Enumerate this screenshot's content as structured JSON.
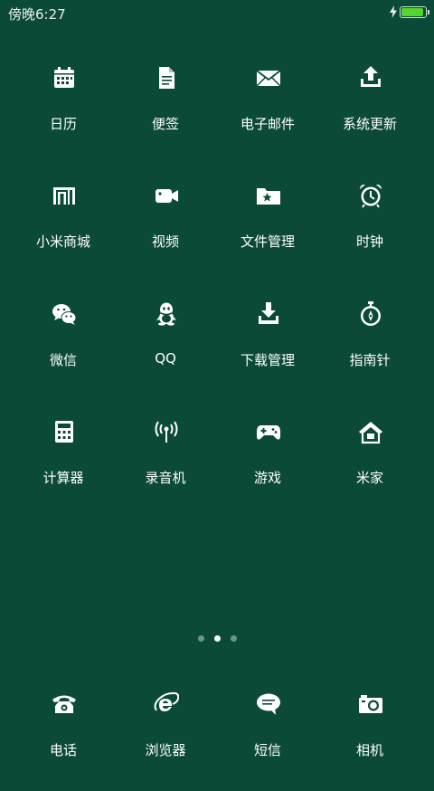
{
  "status": {
    "time": "傍晚6:27",
    "battery_level": 1.0,
    "battery_color": "#53d62b",
    "charging": true
  },
  "grid": [
    {
      "label": "日历",
      "icon": "calendar-icon"
    },
    {
      "label": "便签",
      "icon": "note-icon"
    },
    {
      "label": "电子邮件",
      "icon": "mail-icon"
    },
    {
      "label": "系统更新",
      "icon": "update-icon"
    },
    {
      "label": "小米商城",
      "icon": "mi-store-icon"
    },
    {
      "label": "视频",
      "icon": "video-icon"
    },
    {
      "label": "文件管理",
      "icon": "folder-icon"
    },
    {
      "label": "时钟",
      "icon": "alarm-clock-icon"
    },
    {
      "label": "微信",
      "icon": "wechat-icon"
    },
    {
      "label": "QQ",
      "icon": "qq-icon"
    },
    {
      "label": "下载管理",
      "icon": "download-icon"
    },
    {
      "label": "指南针",
      "icon": "compass-icon"
    },
    {
      "label": "计算器",
      "icon": "calculator-icon"
    },
    {
      "label": "录音机",
      "icon": "recorder-icon"
    },
    {
      "label": "游戏",
      "icon": "gamepad-icon"
    },
    {
      "label": "米家",
      "icon": "home-icon"
    }
  ],
  "pager": {
    "count": 3,
    "active": 2
  },
  "dock": [
    {
      "label": "电话",
      "icon": "phone-icon"
    },
    {
      "label": "浏览器",
      "icon": "browser-icon"
    },
    {
      "label": "短信",
      "icon": "message-icon"
    },
    {
      "label": "相机",
      "icon": "camera-icon"
    }
  ],
  "colors": {
    "background": "#0b4a38",
    "text": "#ffffff",
    "dot_inactive": "#6f9587",
    "dot_active": "#ffffff"
  }
}
